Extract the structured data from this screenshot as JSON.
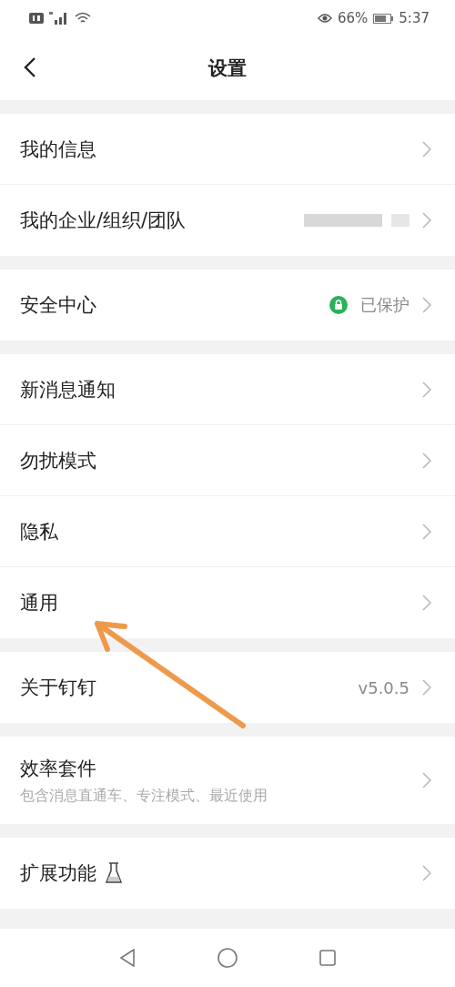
{
  "status_bar": {
    "battery": "66%",
    "time": "5:37"
  },
  "header": {
    "title": "设置"
  },
  "groups": [
    {
      "rows": [
        {
          "kind": "plain",
          "label": "我的信息"
        },
        {
          "kind": "redacted",
          "label": "我的企业/组织/团队"
        }
      ]
    },
    {
      "rows": [
        {
          "kind": "status",
          "label": "安全中心",
          "value": "已保护"
        }
      ]
    },
    {
      "rows": [
        {
          "kind": "plain",
          "label": "新消息通知"
        },
        {
          "kind": "plain",
          "label": "勿扰模式"
        },
        {
          "kind": "plain",
          "label": "隐私"
        },
        {
          "kind": "plain",
          "label": "通用"
        }
      ]
    },
    {
      "rows": [
        {
          "kind": "version",
          "label": "关于钉钉",
          "value": "v5.0.5"
        }
      ]
    },
    {
      "rows": [
        {
          "kind": "subtitle",
          "label": "效率套件",
          "subtitle": "包含消息直通车、专注模式、最近使用"
        }
      ]
    },
    {
      "rows": [
        {
          "kind": "lab",
          "label": "扩展功能"
        }
      ]
    }
  ]
}
